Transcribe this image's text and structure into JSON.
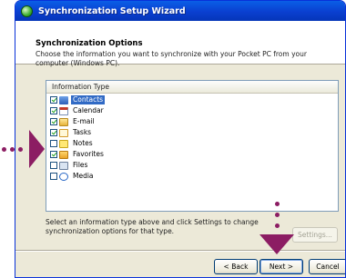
{
  "window": {
    "title": "Synchronization Setup Wizard"
  },
  "header": {
    "title": "Synchronization Options",
    "description": "Choose the information you want to synchronize with your Pocket PC from your computer (Windows PC)."
  },
  "list": {
    "column_header": "Information Type",
    "items": [
      {
        "label": "Contacts",
        "checked": true,
        "icon": "contacts-icon",
        "selected": true
      },
      {
        "label": "Calendar",
        "checked": true,
        "icon": "calendar-icon",
        "selected": false
      },
      {
        "label": "E-mail",
        "checked": true,
        "icon": "email-icon",
        "selected": false
      },
      {
        "label": "Tasks",
        "checked": true,
        "icon": "tasks-icon",
        "selected": false
      },
      {
        "label": "Notes",
        "checked": false,
        "icon": "notes-icon",
        "selected": false
      },
      {
        "label": "Favorites",
        "checked": true,
        "icon": "favorites-icon",
        "selected": false
      },
      {
        "label": "Files",
        "checked": false,
        "icon": "files-icon",
        "selected": false
      },
      {
        "label": "Media",
        "checked": false,
        "icon": "media-icon",
        "selected": false
      }
    ]
  },
  "footer": {
    "instructions": "Select an information type above and click Settings to change synchronization options for that type.",
    "settings_label": "Settings...",
    "back_label": "< Back",
    "next_label": "Next >",
    "cancel_label": "Cancel"
  },
  "colors": {
    "annotation": "#8c1d63",
    "selection": "#316ac5",
    "titlebar": "#0a48d8"
  }
}
